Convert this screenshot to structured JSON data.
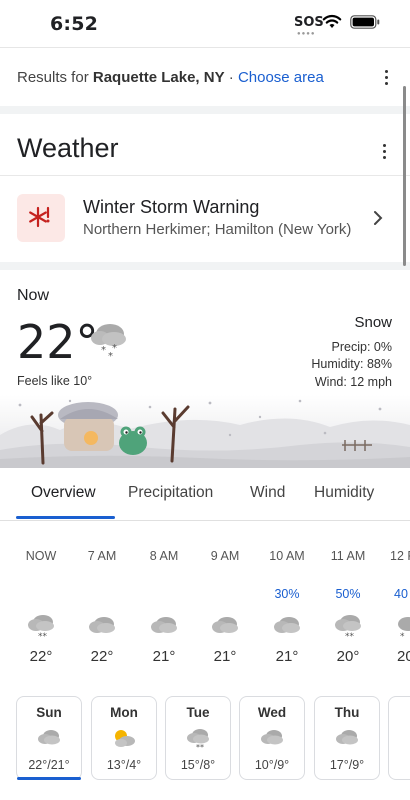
{
  "status_bar": {
    "time": "6:52",
    "sos": "SOS"
  },
  "results": {
    "prefix": "Results for",
    "place": "Raquette Lake, NY",
    "separator": "·",
    "choose_area": "Choose area"
  },
  "weather": {
    "title": "Weather",
    "alert": {
      "title": "Winter Storm Warning",
      "subtitle": "Northern Herkimer; Hamilton (New York)"
    },
    "now": {
      "label": "Now",
      "temperature": "22°",
      "feels_like": "Feels like 10°",
      "condition": "Snow",
      "precip": "Precip: 0%",
      "humidity": "Humidity: 88%",
      "wind": "Wind: 12 mph"
    },
    "tabs": [
      "Overview",
      "Precipitation",
      "Wind",
      "Humidity"
    ],
    "active_tab": "Overview",
    "hourly": [
      {
        "label": "NOW",
        "precip": "",
        "icon": "snow-cloud-icon",
        "temp": "22°"
      },
      {
        "label": "7 AM",
        "precip": "",
        "icon": "cloud-icon",
        "temp": "22°"
      },
      {
        "label": "8 AM",
        "precip": "",
        "icon": "cloud-icon",
        "temp": "21°"
      },
      {
        "label": "9 AM",
        "precip": "",
        "icon": "cloud-icon",
        "temp": "21°"
      },
      {
        "label": "10 AM",
        "precip": "30%",
        "icon": "cloud-icon",
        "temp": "21°"
      },
      {
        "label": "11 AM",
        "precip": "50%",
        "icon": "snow-cloud-icon",
        "temp": "20°"
      },
      {
        "label": "12 P",
        "precip": "40",
        "icon": "snow-cloud-icon",
        "temp": "20"
      }
    ],
    "daily": [
      {
        "day": "Sun",
        "icon": "cloud-icon",
        "temps": "22°/21°"
      },
      {
        "day": "Mon",
        "icon": "partly-sunny-icon",
        "temps": "13°/4°"
      },
      {
        "day": "Tue",
        "icon": "snow-cloud-icon",
        "temps": "15°/8°"
      },
      {
        "day": "Wed",
        "icon": "cloud-icon",
        "temps": "10°/9°"
      },
      {
        "day": "Thu",
        "icon": "cloud-icon",
        "temps": "17°/9°"
      }
    ],
    "active_day": "Sun"
  },
  "colors": {
    "accent": "#1a5fd0",
    "alert_bg": "#fce8e6",
    "alert_icon": "#c5221f"
  }
}
